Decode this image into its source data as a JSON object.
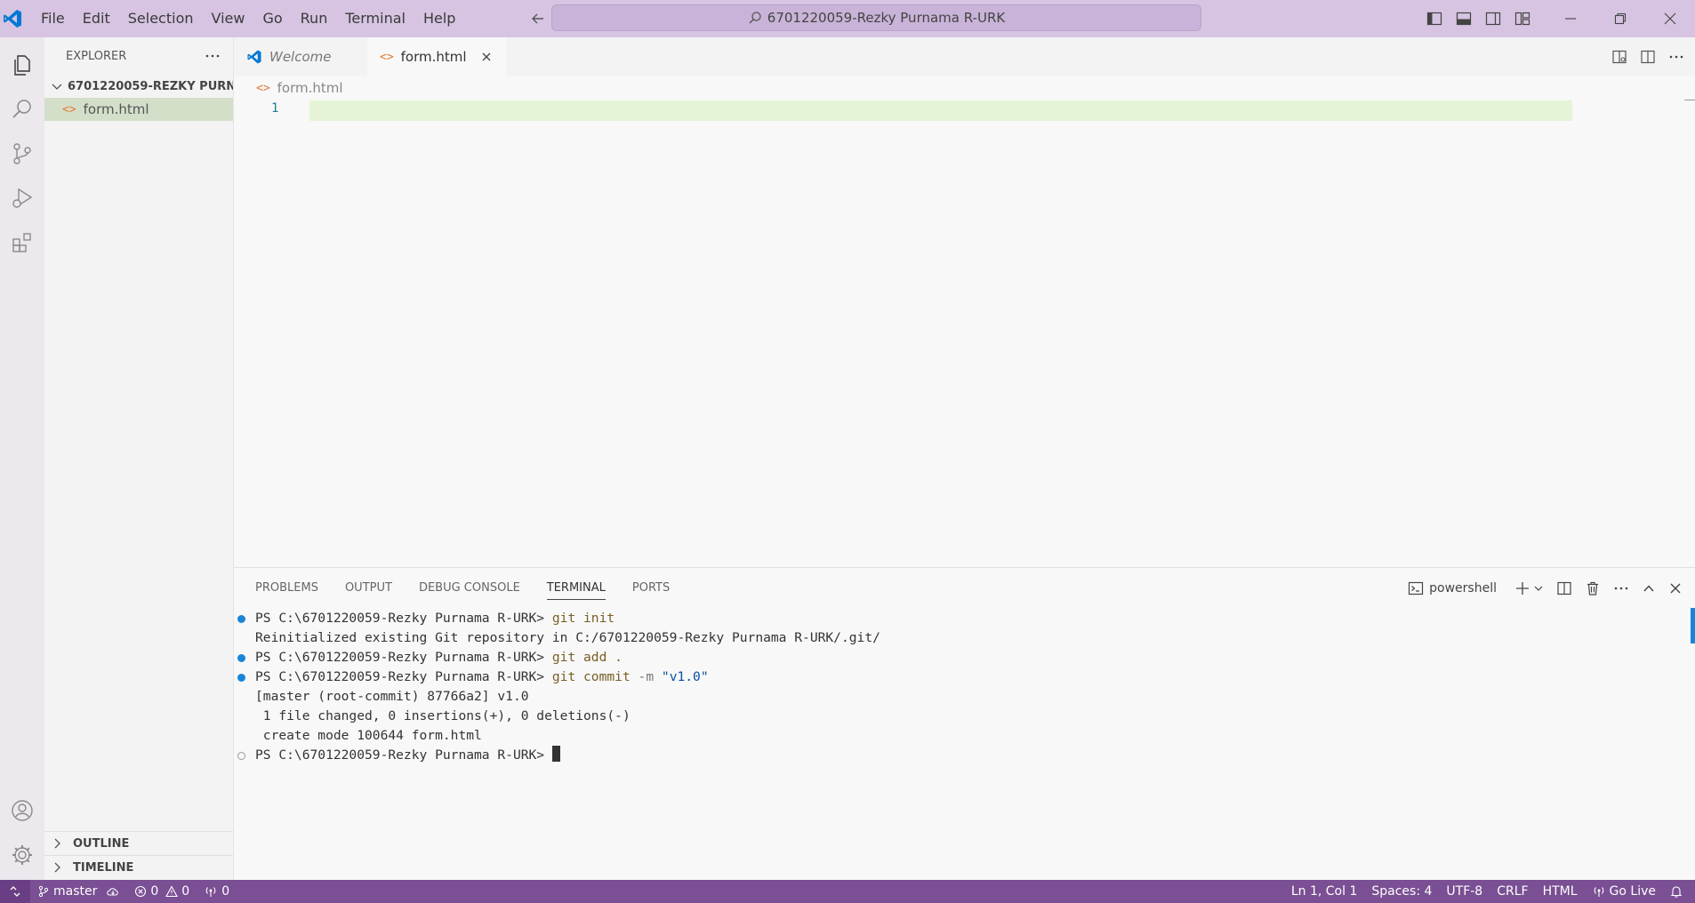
{
  "titlebar": {
    "menu": [
      "File",
      "Edit",
      "Selection",
      "View",
      "Go",
      "Run",
      "Terminal",
      "Help"
    ],
    "search_text": "6701220059-Rezky Purnama R-URK"
  },
  "sidebar": {
    "title": "EXPLORER",
    "folder": "6701220059-REZKY PURN...",
    "files": [
      "form.html"
    ],
    "outline": "OUTLINE",
    "timeline": "TIMELINE"
  },
  "editor": {
    "tabs": [
      {
        "label": "Welcome",
        "active": false
      },
      {
        "label": "form.html",
        "active": true
      }
    ],
    "breadcrumb": "form.html",
    "line_number": "1"
  },
  "panel": {
    "tabs": [
      "PROBLEMS",
      "OUTPUT",
      "DEBUG CONSOLE",
      "TERMINAL",
      "PORTS"
    ],
    "active_tab": "TERMINAL",
    "shell": "powershell",
    "terminal": {
      "prompt": "PS C:\\6701220059-Rezky Purnama R-URK> ",
      "l1_cmd": "git init",
      "l2": "Reinitialized existing Git repository in C:/6701220059-Rezky Purnama R-URK/.git/",
      "l3_cmd": "git add .",
      "l4_cmd": "git commit",
      "l4_flag": " -m ",
      "l4_str": "\"v1.0\"",
      "l5": "[master (root-commit) 87766a2] v1.0",
      "l6": " 1 file changed, 0 insertions(+), 0 deletions(-)",
      "l7": " create mode 100644 form.html"
    }
  },
  "statusbar": {
    "branch": "master",
    "errors": "0",
    "warnings": "0",
    "ports": "0",
    "position": "Ln 1, Col 1",
    "spaces": "Spaces: 4",
    "encoding": "UTF-8",
    "eol": "CRLF",
    "language": "HTML",
    "live": "Go Live"
  },
  "colors": {
    "titlebar": "#d6c4e2",
    "statusbar": "#7a4f94",
    "accent": "#1a85d6",
    "current_line": "#e5f4d7"
  }
}
